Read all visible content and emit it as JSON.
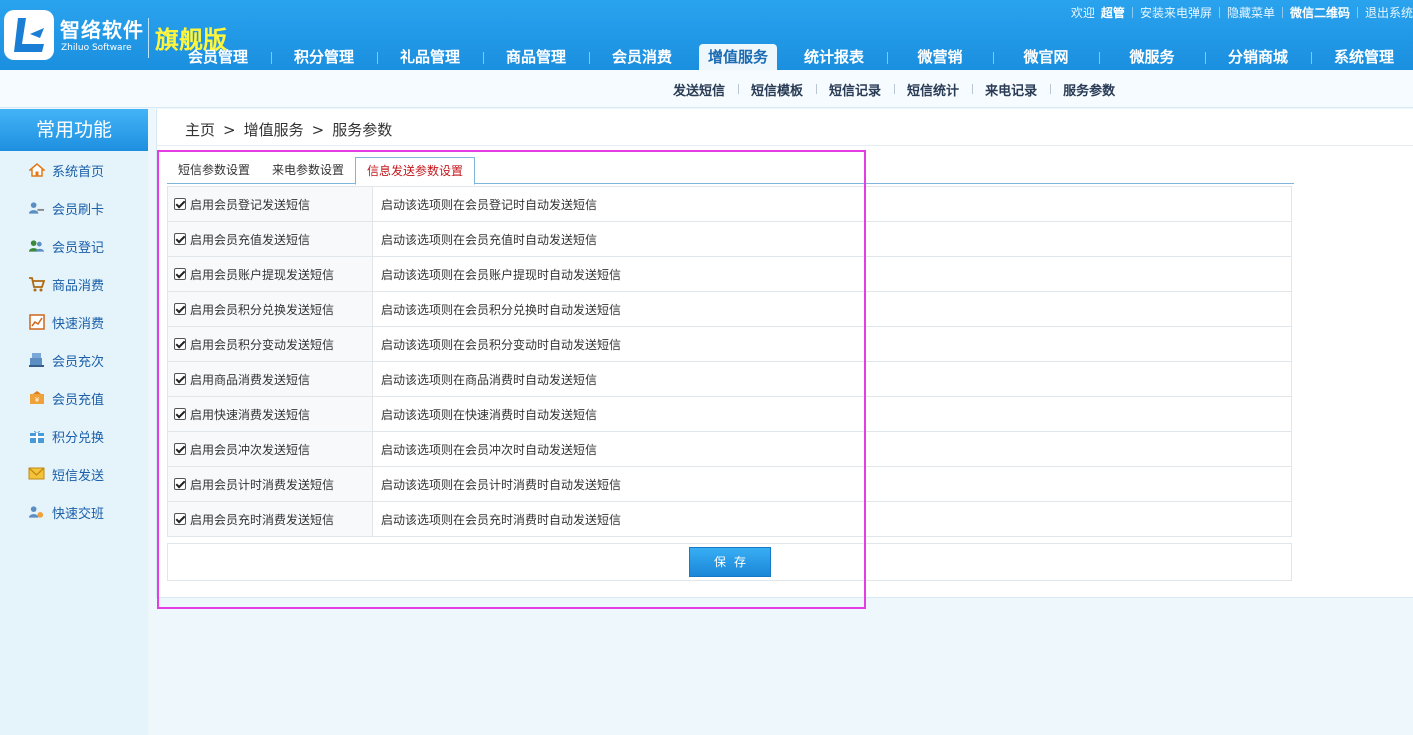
{
  "brand": {
    "name_cn": "智络软件",
    "name_en": "Zhiluo Software",
    "edition": "旗舰版"
  },
  "topbar": {
    "welcome": "欢迎",
    "user": "超管",
    "install_popup": "安装来电弹屏",
    "hide_menu": "隐藏菜单",
    "wechat_qr": "微信二维码",
    "logout": "退出系统"
  },
  "nav": {
    "items": [
      "会员管理",
      "积分管理",
      "礼品管理",
      "商品管理",
      "会员消费",
      "增值服务",
      "统计报表",
      "微营销",
      "微官网",
      "微服务",
      "分销商城",
      "系统管理"
    ],
    "active_index": 5
  },
  "subnav": {
    "items": [
      "发送短信",
      "短信模板",
      "短信记录",
      "短信统计",
      "来电记录",
      "服务参数"
    ]
  },
  "sidebar": {
    "title": "常用功能",
    "items": [
      {
        "label": "系统首页",
        "icon": "home-icon"
      },
      {
        "label": "会员刷卡",
        "icon": "member-card-icon"
      },
      {
        "label": "会员登记",
        "icon": "member-register-icon"
      },
      {
        "label": "商品消费",
        "icon": "cart-icon"
      },
      {
        "label": "快速消费",
        "icon": "chart-icon"
      },
      {
        "label": "会员充次",
        "icon": "register-icon"
      },
      {
        "label": "会员充值",
        "icon": "recharge-icon"
      },
      {
        "label": "积分兑换",
        "icon": "gift-icon"
      },
      {
        "label": "短信发送",
        "icon": "mail-icon"
      },
      {
        "label": "快速交班",
        "icon": "handover-icon"
      }
    ]
  },
  "breadcrumb": {
    "home": "主页",
    "level1": "增值服务",
    "level2": "服务参数",
    "sep": ">"
  },
  "tabs": {
    "items": [
      "短信参数设置",
      "来电参数设置",
      "信息发送参数设置"
    ],
    "active_index": 2
  },
  "settings": [
    {
      "label": "启用会员登记发送短信",
      "desc": "启动该选项则在会员登记时自动发送短信",
      "checked": true
    },
    {
      "label": "启用会员充值发送短信",
      "desc": "启动该选项则在会员充值时自动发送短信",
      "checked": true
    },
    {
      "label": "启用会员账户提现发送短信",
      "desc": "启动该选项则在会员账户提现时自动发送短信",
      "checked": true
    },
    {
      "label": "启用会员积分兑换发送短信",
      "desc": "启动该选项则在会员积分兑换时自动发送短信",
      "checked": true
    },
    {
      "label": "启用会员积分变动发送短信",
      "desc": "启动该选项则在会员积分变动时自动发送短信",
      "checked": true
    },
    {
      "label": "启用商品消费发送短信",
      "desc": "启动该选项则在商品消费时自动发送短信",
      "checked": true
    },
    {
      "label": "启用快速消费发送短信",
      "desc": "启动该选项则在快速消费时自动发送短信",
      "checked": true
    },
    {
      "label": "启用会员冲次发送短信",
      "desc": "启动该选项则在会员冲次时自动发送短信",
      "checked": true
    },
    {
      "label": "启用会员计时消费发送短信",
      "desc": "启动该选项则在会员计时消费时自动发送短信",
      "checked": true
    },
    {
      "label": "启用会员充时消费发送短信",
      "desc": "启动该选项则在会员充时消费时自动发送短信",
      "checked": true
    }
  ],
  "save_label": "保存"
}
